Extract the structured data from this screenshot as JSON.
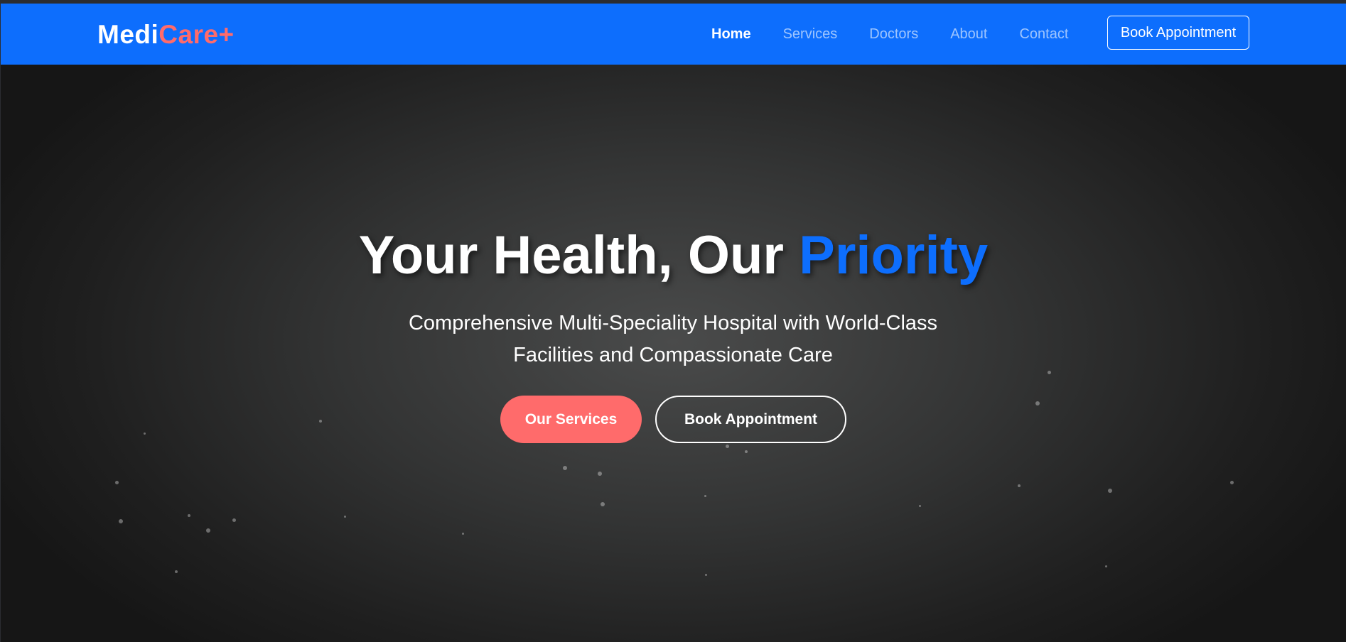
{
  "navbar": {
    "brand_main": "Medi",
    "brand_accent": "Care+",
    "links": [
      {
        "label": "Home",
        "active": true
      },
      {
        "label": "Services",
        "active": false
      },
      {
        "label": "Doctors",
        "active": false
      },
      {
        "label": "About",
        "active": false
      },
      {
        "label": "Contact",
        "active": false
      }
    ],
    "cta_label": "Book Appointment"
  },
  "hero": {
    "title_main": "Your Health, Our ",
    "title_highlight": "Priority",
    "subtitle": "Comprehensive Multi-Speciality Hospital with World-Class Facilities and Compassionate Care",
    "primary_button": "Our Services",
    "secondary_button": "Book Appointment"
  },
  "colors": {
    "nav_background": "#0d6efd",
    "brand_accent": "#ff6b6b",
    "title_highlight": "#0d6efd",
    "primary_button": "#ff6b6b"
  }
}
